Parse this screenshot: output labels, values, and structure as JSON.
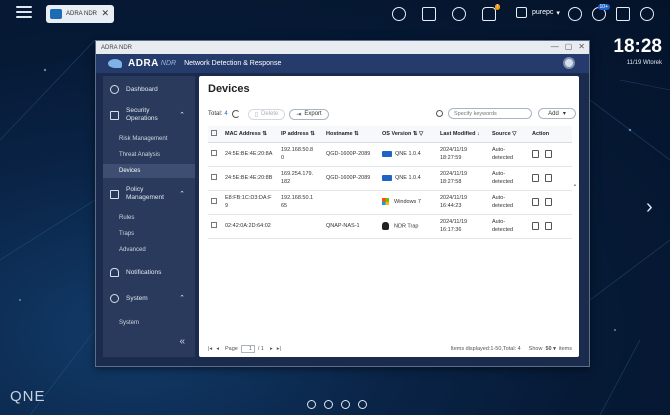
{
  "taskbar": {
    "tab_label": "ADRA NDR",
    "user_name": "purepc",
    "notification_count": "10+"
  },
  "clock": {
    "time": "18:28",
    "date": "11/19 Wtorek"
  },
  "desktop": {
    "os_logo": "QNE"
  },
  "window": {
    "title": "ADRA NDR",
    "brand": "ADRA",
    "brand_sub": "NDR",
    "tagline": "Network Detection & Response"
  },
  "sidebar": {
    "dashboard": "Dashboard",
    "security_ops": "Security Operations",
    "risk_management": "Risk Management",
    "threat_analysis": "Threat Analysis",
    "devices": "Devices",
    "policy_management": "Policy Management",
    "rules": "Rules",
    "traps": "Traps",
    "advanced": "Advanced",
    "notifications": "Notifications",
    "system": "System",
    "system_sub": "System"
  },
  "main": {
    "title": "Devices",
    "total_label": "Total:",
    "total_value": "4",
    "delete_label": "Delete",
    "export_label": "Export",
    "search_placeholder": "Specify keywords",
    "add_label": "Add"
  },
  "table": {
    "headers": [
      "MAC Address",
      "IP address",
      "Hostname",
      "OS Version",
      "Last Modified",
      "Source",
      "Action"
    ],
    "rows": [
      {
        "mac": "24:5E:BE:4E:20:8A",
        "ip_l1": "192.168.50.8",
        "ip_l2": "0",
        "host": "QGD-1600P-2089",
        "os": "QNE 1.0.4",
        "mod_d": "2024/11/19",
        "mod_t": "18:27:59",
        "src_l1": "Auto-",
        "src_l2": "detected"
      },
      {
        "mac": "24:5E:BE:4E:20:8B",
        "ip_l1": "169.254.179.",
        "ip_l2": "182",
        "host": "QGD-1600P-2089",
        "os": "QNE 1.0.4",
        "mod_d": "2024/11/19",
        "mod_t": "18:27:58",
        "src_l1": "Auto-",
        "src_l2": "detected"
      },
      {
        "mac_l1": "E8:FB:1C:D3:DA:F",
        "mac_l2": "9",
        "ip_l1": "192.168.50.1",
        "ip_l2": "65",
        "host": "",
        "os": "Windows 7",
        "mod_d": "2024/11/19",
        "mod_t": "16:44:23",
        "src_l1": "Auto-",
        "src_l2": "detected"
      },
      {
        "mac": "02:42:0A:2D:64:02",
        "ip_l1": "",
        "ip_l2": "",
        "host": "QNAP-NAS-1",
        "os": "NDR Trap",
        "mod_d": "2024/11/19",
        "mod_t": "16:17:36",
        "src_l1": "Auto-",
        "src_l2": "detected"
      }
    ]
  },
  "pager": {
    "page_label": "Page",
    "page_value": "1",
    "page_total": "/ 1",
    "items_displayed": "Items displayed:1-50,Total: 4",
    "show_label": "Show",
    "show_value": "50",
    "items_label": "items"
  },
  "colors": {
    "accent": "#1e64c8",
    "sidebar_bg": "#2a3a5c",
    "header_bg": "#243b6b"
  }
}
